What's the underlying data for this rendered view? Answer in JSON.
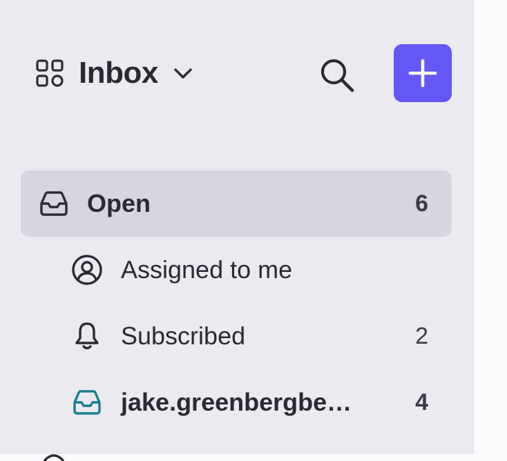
{
  "header": {
    "title": "Inbox",
    "switcher_icon": "grid-icon",
    "chevron_icon": "chevron-down-icon",
    "search_icon": "search-icon",
    "compose_icon": "plus-icon"
  },
  "nav": [
    {
      "label": "Open",
      "count": "6",
      "icon": "inbox-tray-icon",
      "active": true
    },
    {
      "label": "Assigned to me",
      "count": "",
      "icon": "user-circle-icon"
    },
    {
      "label": "Subscribed",
      "count": "2",
      "icon": "bell-icon"
    },
    {
      "label": "jake.greenbergbe…",
      "count": "4",
      "icon": "inbox-tray-icon"
    }
  ],
  "colors": {
    "accent": "#6457f5",
    "sidebar_bg": "#ebeaf1",
    "active_bg": "#d6d5e0",
    "mailbox_icon": "#17808f",
    "text": "#2a2a33"
  }
}
